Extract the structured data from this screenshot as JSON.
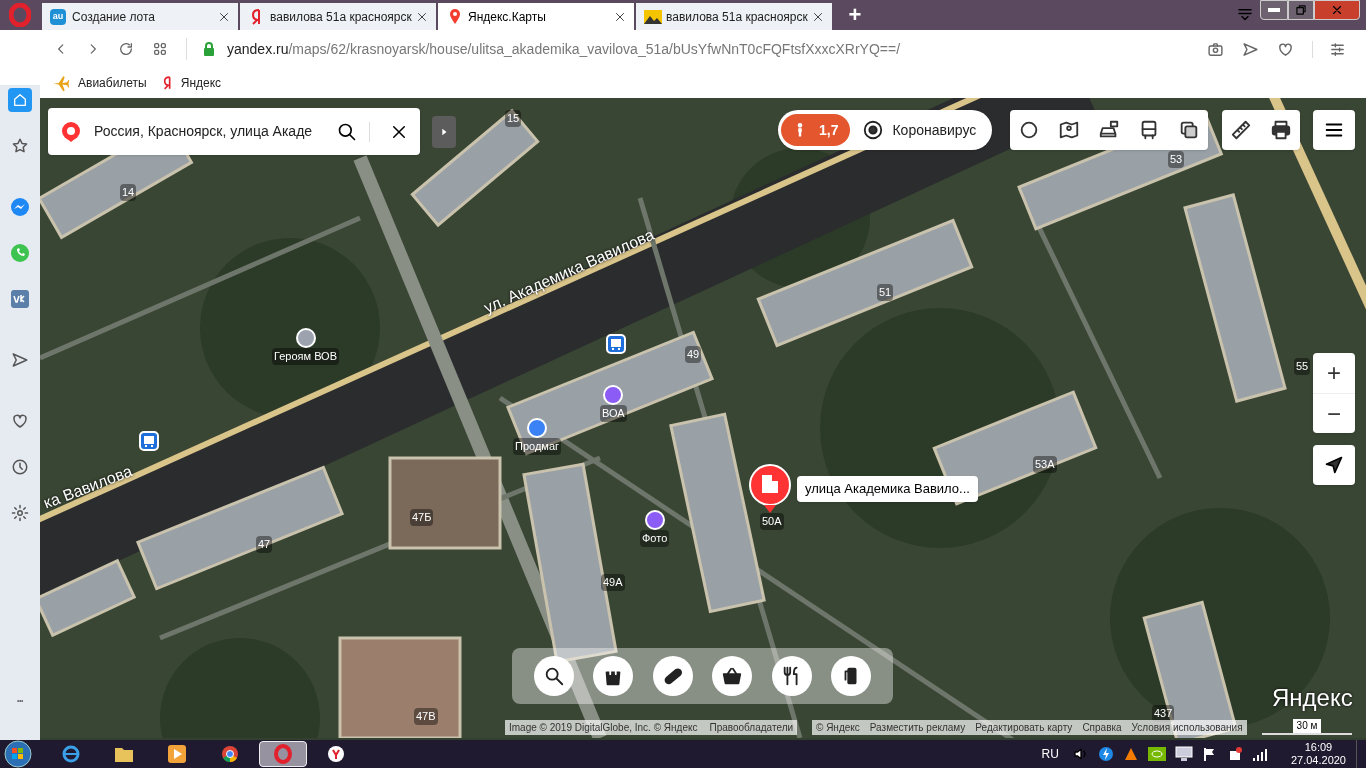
{
  "browser": {
    "tabs": [
      {
        "title": "Создание лота",
        "selected": false,
        "logo_text": "au"
      },
      {
        "title": "вавилова 51а красноярск",
        "selected": false
      },
      {
        "title": "Яндекс.Карты",
        "selected": true
      },
      {
        "title": "вавилова 51а красноярск",
        "selected": false
      }
    ],
    "new_tab": "+",
    "address": {
      "domain": "yandex.ru",
      "path": "/maps/62/krasnoyarsk/house/ulitsa_akademika_vavilova_51a/bUsYfwNnT0cFQFtsfXxxcXRrYQ==/"
    },
    "bookmarks": [
      "Авиабилеты",
      "Яндекс"
    ]
  },
  "sidebar": {
    "items": [
      {
        "selected": true
      },
      {
        "selected": false
      },
      {
        "selected": false
      },
      {
        "selected": false
      },
      {
        "selected": false
      },
      {
        "selected": false
      },
      {
        "selected": false
      },
      {
        "selected": false
      },
      {
        "selected": false
      }
    ]
  },
  "map": {
    "search": {
      "value": "Россия, Красноярск, улица Акаде"
    },
    "traffic": {
      "score": "1,7"
    },
    "corona": "Коронавирус",
    "zoom_in": "+",
    "zoom_out": "−",
    "labels": [
      {
        "kind": "street",
        "text": "ул. Академика Вавилова"
      },
      {
        "kind": "street",
        "text": "ка Вавилова"
      },
      {
        "kind": "house",
        "text": "15"
      },
      {
        "kind": "house",
        "text": "14"
      },
      {
        "kind": "house",
        "text": "51"
      },
      {
        "kind": "house",
        "text": "53"
      },
      {
        "kind": "house",
        "text": "49"
      },
      {
        "kind": "house",
        "text": "55"
      },
      {
        "kind": "house",
        "text": "47Б"
      },
      {
        "kind": "house",
        "text": "47"
      },
      {
        "kind": "house",
        "text": "50А"
      },
      {
        "kind": "house",
        "text": "53А"
      },
      {
        "kind": "house",
        "text": "49А"
      },
      {
        "kind": "house",
        "text": "47В"
      },
      {
        "kind": "house",
        "text": "437"
      },
      {
        "kind": "poi",
        "text": "Героям ВОВ",
        "color": "#9ca3af"
      },
      {
        "kind": "poi",
        "text": "ВОА",
        "color": "#8b5cf6"
      },
      {
        "kind": "poi",
        "text": "Продмаг",
        "color": "#3b82f6"
      },
      {
        "kind": "poi",
        "text": "Фото",
        "color": "#8b5cf6"
      }
    ],
    "marker": {
      "label": "улица Академика Вавило..."
    },
    "logo": "Яндекс",
    "scale": "30 м",
    "copyright": [
      "Image © 2019 DigitalGlobe, Inc. © Яндекс",
      "Правообладатели"
    ],
    "links": [
      "© Яндекс",
      "Разместить рекламу",
      "Редактировать карту",
      "Справка",
      "Условия использования"
    ]
  },
  "taskbar": {
    "apps": [
      {
        "selected": false
      },
      {
        "selected": false
      },
      {
        "selected": false
      },
      {
        "selected": false
      },
      {
        "selected": true
      },
      {
        "selected": false
      }
    ],
    "language": "RU",
    "time": "16:09",
    "date": "27.04.2020"
  }
}
